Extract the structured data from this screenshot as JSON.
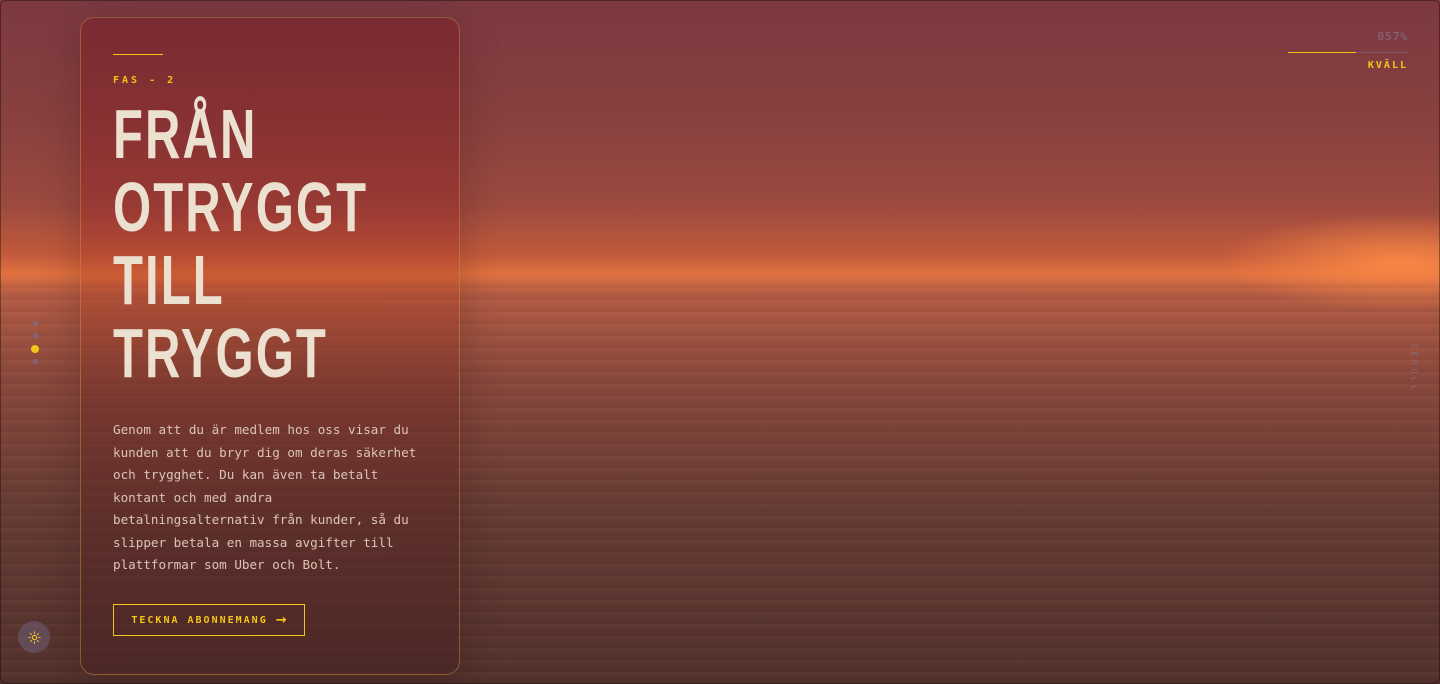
{
  "hero": {
    "eyebrow": "FAS - 2",
    "headline": [
      "FRÅN",
      "OTRYGGT",
      "TILL",
      "TRYGGT"
    ],
    "body": "Genom att du är medlem hos oss visar du kunden att du bryr dig om deras säkerhet och trygghet. Du kan även ta betalt kontant och med andra betalningsalternativ från kunder, så du slipper betala en massa avgifter till plattformar som Uber och Bolt.",
    "cta_label": "TECKNA ABONNEMANG",
    "cta_icon": "arrow-right-icon"
  },
  "progress": {
    "percent_label": "057%",
    "value": 0.57,
    "phase_label": "KVÄLL"
  },
  "side_nav": {
    "count": 4,
    "active_index": 2
  },
  "vertical_label": "SKROLL",
  "theme_toggle": {
    "icon": "sun-icon"
  },
  "colors": {
    "accent": "#f2c617",
    "headline": "#ece0d0",
    "body_text": "#dcc4b8"
  }
}
